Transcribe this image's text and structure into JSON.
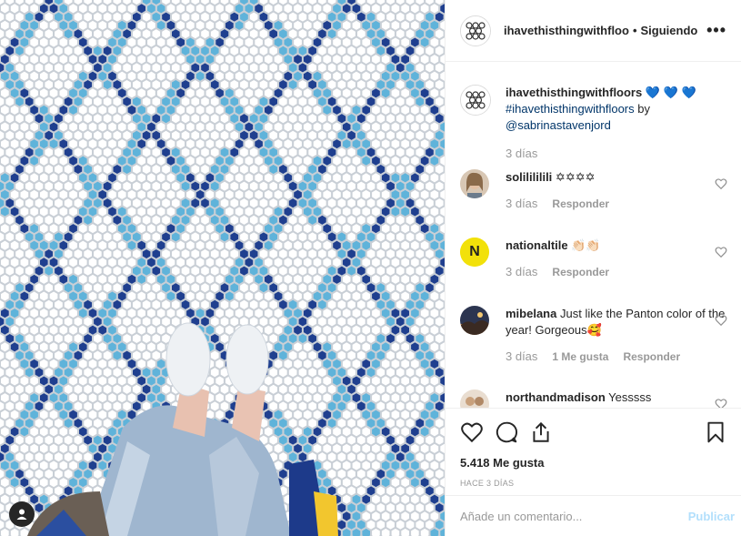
{
  "post": {
    "username": "ihavethisthingwithfloo",
    "separator": "•",
    "follow_status": "Siguiendo",
    "more_glyph": "•••"
  },
  "caption": {
    "username": "ihavethisthingwithfloors",
    "emoji": "💙 💙 💙",
    "hashtag": "#ihavethisthingwithfloors",
    "by": "by",
    "mention": "@sabrinastavenjord",
    "time": "3 días"
  },
  "comments": [
    {
      "username": "solilililili",
      "text": "✡✡✡✡",
      "time": "3 días",
      "reply": "Responder",
      "likes": ""
    },
    {
      "username": "nationaltile",
      "text": "👏🏻👏🏻",
      "time": "3 días",
      "reply": "Responder",
      "likes": "",
      "avatar_letter": "N"
    },
    {
      "username": "mibelana",
      "text": "Just like the Panton color of the year! Gorgeous🥰",
      "time": "3 días",
      "reply": "Responder",
      "likes": "1 Me gusta"
    },
    {
      "username": "northandmadison",
      "text": "Yesssss",
      "time": "",
      "reply": "",
      "likes": ""
    }
  ],
  "stats": {
    "likes": "5.418 Me gusta",
    "ago": "HACE 3 DÍAS"
  },
  "composer": {
    "placeholder": "Añade un comentario...",
    "publish": "Publicar"
  },
  "colors": {
    "tile_white": "#ffffff",
    "grout": "#c9cfd6",
    "tile_light_blue": "#5fb3da",
    "tile_navy": "#1f3f8f",
    "link": "#003569",
    "publish_disabled": "#b2dffc"
  },
  "icons": [
    "person-tag-icon",
    "heart-icon",
    "comment-icon",
    "share-icon",
    "bookmark-icon",
    "more-options-icon"
  ]
}
